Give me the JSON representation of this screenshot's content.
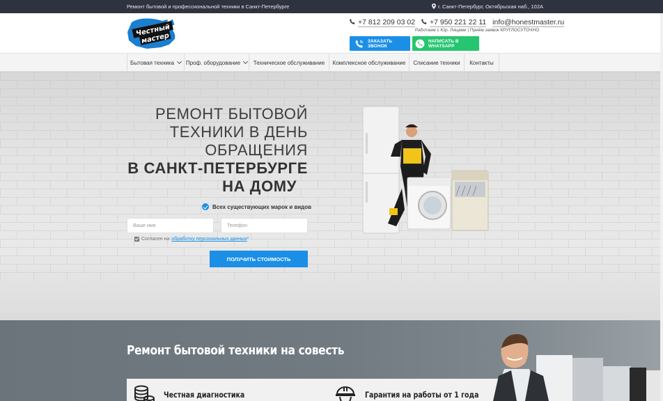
{
  "topbar": {
    "tagline": "Ремонт бытовой и профессиональной техники в Санкт-Петербурге",
    "address": "г. Санкт-Петербург, Октябрьская наб., 102А"
  },
  "header": {
    "logo_text_top": "Честный",
    "logo_text_bottom": "мастер",
    "phone1": "+7 812 209 03 02",
    "phone2": "+7 950 221 22 11",
    "email": "info@honestmaster.ru",
    "worktime": "Работаем с Юр. Лицами | Приём заявок КРУГЛОСУТОЧНО",
    "call_button": "ЗАКАЗАТЬ ЗВОНОК",
    "whatsapp_button": "НАПИСАТЬ В WHATSAPP"
  },
  "nav": {
    "items": [
      {
        "label": "Бытовая техника"
      },
      {
        "label": "Проф. оборудование"
      },
      {
        "label": "Техническое обслуживание"
      },
      {
        "label": "Комплексное обслуживание"
      },
      {
        "label": "Списание техники"
      },
      {
        "label": "Контакты"
      }
    ]
  },
  "hero": {
    "title_line1": "РЕМОНТ БЫТОВОЙ",
    "title_line2": "ТЕХНИКИ В ДЕНЬ",
    "title_line3": "ОБРАЩЕНИЯ",
    "title_line4": "В САНКТ-ПЕТЕРБУРГЕ",
    "title_line5": "НА ДОМУ",
    "feature": "Всех существующих марок и видов",
    "name_placeholder": "Ваше имя",
    "phone_placeholder": "Телефон",
    "consent_text": "Согласен на",
    "consent_link": "обработку персональных данных",
    "consent_required": "*",
    "submit": "ПОЛУЧИТЬ СТОИМОСТЬ"
  },
  "section2": {
    "title": "Ремонт бытовой техники на совесть",
    "features": [
      {
        "label": "Честная диагностика"
      },
      {
        "label": "Гарантия на работы от 1 года"
      }
    ]
  },
  "colors": {
    "accent_blue": "#1b8fe6",
    "whatsapp_green": "#26c56f",
    "topbar_bg": "#2f3340",
    "section2_bg": "#6f787f"
  },
  "icons": [
    "pin-icon",
    "phone-icon",
    "call-icon",
    "whatsapp-icon",
    "chevron-down-icon",
    "check-circle-icon",
    "checkbox-icon",
    "coins-icon",
    "worker-helmet-icon"
  ]
}
